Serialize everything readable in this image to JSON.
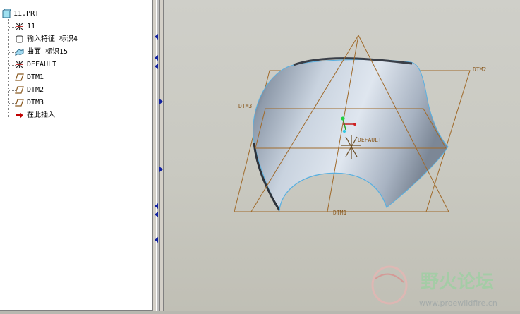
{
  "tree": {
    "root_label": "11.PRT",
    "items": [
      {
        "label": "11",
        "icon": "coordinate-system-icon"
      },
      {
        "label": "输入特征 标识4",
        "icon": "import-feature-icon"
      },
      {
        "label": "曲面 标识15",
        "icon": "surface-icon"
      },
      {
        "label": "DEFAULT",
        "icon": "coordinate-system-icon"
      },
      {
        "label": "DTM1",
        "icon": "datum-plane-icon"
      },
      {
        "label": "DTM2",
        "icon": "datum-plane-icon"
      },
      {
        "label": "DTM3",
        "icon": "datum-plane-icon"
      },
      {
        "label": "在此插入",
        "icon": "insert-here-arrow-icon"
      }
    ]
  },
  "viewport": {
    "datum_labels": {
      "dtm1": "DTM1",
      "dtm2": "DTM2",
      "dtm3": "DTM3",
      "csys": "DEFAULT"
    }
  },
  "watermark": {
    "site_name": "野火论坛",
    "url": "www.proewildfire.cn"
  },
  "colors": {
    "datum_plane": "#a06a2a",
    "surface_edge": "#5ab0e0",
    "tree_background": "#ffffff",
    "insert_arrow": "#c00000"
  }
}
